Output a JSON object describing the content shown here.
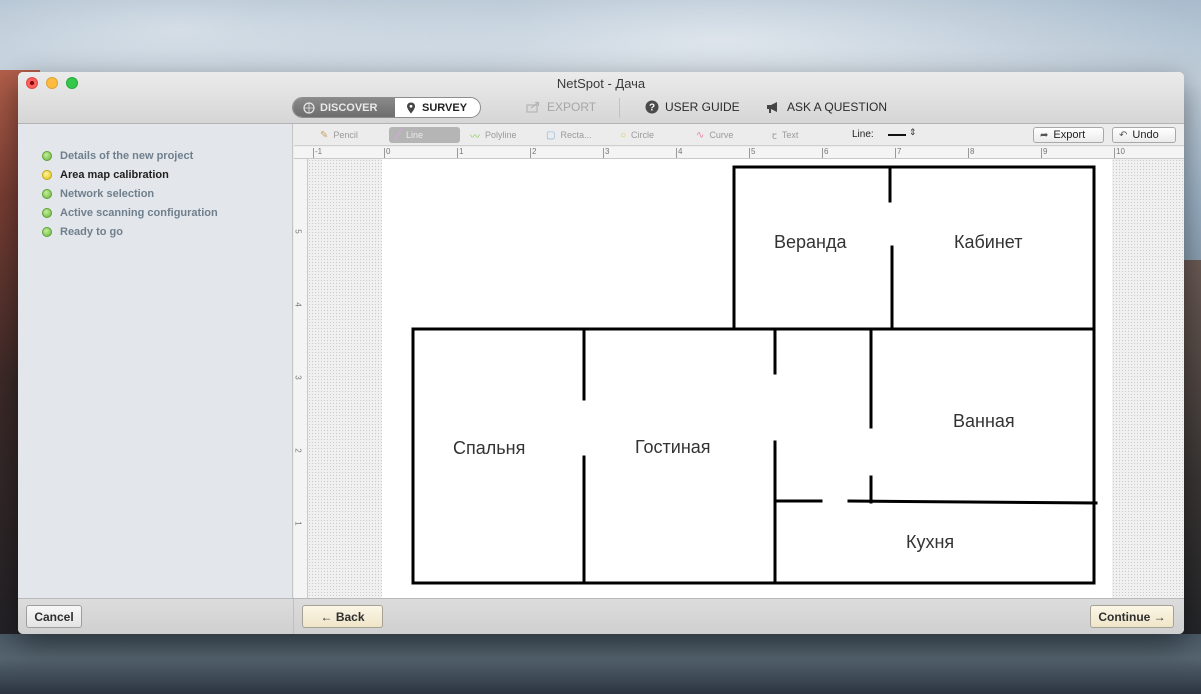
{
  "window": {
    "title": "NetSpot - Дача"
  },
  "toolbar": {
    "segments": {
      "discover": "DISCOVER",
      "survey": "SURVEY"
    },
    "export": "EXPORT",
    "user_guide": "USER GUIDE",
    "ask_question": "ASK A QUESTION"
  },
  "sidebar": {
    "steps": [
      {
        "label": "Details of the new project",
        "status": "done"
      },
      {
        "label": "Area map calibration",
        "status": "current"
      },
      {
        "label": "Network selection",
        "status": "done"
      },
      {
        "label": "Active scanning configuration",
        "status": "done"
      },
      {
        "label": "Ready to go",
        "status": "done"
      }
    ]
  },
  "drawing_tools": {
    "pencil": "Pencil",
    "line": "Line",
    "polyline": "Polyline",
    "rectangle": "Recta...",
    "circle": "Circle",
    "curve": "Curve",
    "text": "Text",
    "line_label": "Line:",
    "export": "Export",
    "undo": "Undo",
    "selected_tool": "line"
  },
  "ruler": {
    "horizontal": [
      "-1",
      "0",
      "1",
      "2",
      "3",
      "4",
      "5",
      "6",
      "7",
      "8",
      "9",
      "10"
    ],
    "vertical": [
      "5",
      "4",
      "3",
      "2",
      "1"
    ]
  },
  "floor_plan": {
    "rooms": {
      "veranda": "Веранда",
      "cabinet": "Кабинет",
      "bedroom": "Спальня",
      "living": "Гостиная",
      "bathroom": "Ванная",
      "kitchen": "Кухня"
    }
  },
  "footer": {
    "cancel": "Cancel",
    "back": "← Back",
    "continue": "Continue →"
  },
  "colors": {
    "step_done": "#67b63b",
    "step_current": "#e2c20f",
    "close": "#fc605c",
    "minimize": "#fdbc40",
    "maximize": "#34c84a"
  }
}
